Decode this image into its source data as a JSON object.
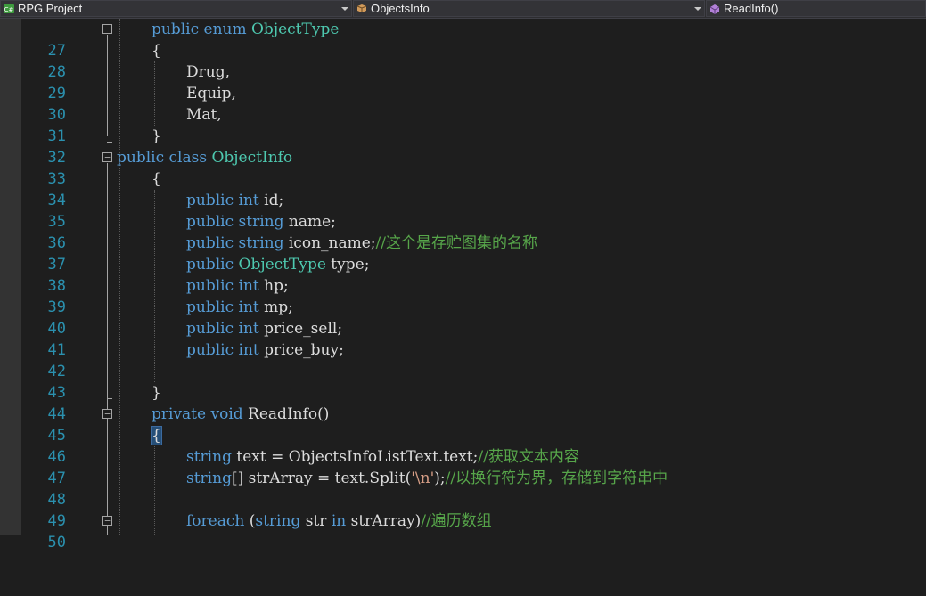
{
  "navbar": {
    "project": "RPG Project",
    "class": "ObjectsInfo",
    "member": "ReadInfo()"
  },
  "colors": {
    "background": "#1e1e1e",
    "keyword": "#569cd6",
    "type": "#4ec9b0",
    "comment": "#57a64a",
    "string": "#d69d85",
    "line_number": "#2b91af",
    "text": "#dcdcdc"
  },
  "lines": [
    {
      "n": "27",
      "text": "public enum ObjectType"
    },
    {
      "n": "28",
      "text": "{"
    },
    {
      "n": "29",
      "text": "Drug,"
    },
    {
      "n": "30",
      "text": "Equip,"
    },
    {
      "n": "31",
      "text": "Mat,"
    },
    {
      "n": "32",
      "text": "}"
    },
    {
      "n": "33",
      "text": "public class ObjectInfo"
    },
    {
      "n": "34",
      "text": "{"
    },
    {
      "n": "35",
      "text": "public int id;"
    },
    {
      "n": "36",
      "text": "public string name;"
    },
    {
      "n": "37",
      "text": "public string icon_name;//这个是存贮图集的名称"
    },
    {
      "n": "38",
      "text": "public ObjectType type;"
    },
    {
      "n": "39",
      "text": "public int hp;"
    },
    {
      "n": "40",
      "text": "public int mp;"
    },
    {
      "n": "41",
      "text": "public int price_sell;"
    },
    {
      "n": "42",
      "text": "public int price_buy;"
    },
    {
      "n": "43",
      "text": ""
    },
    {
      "n": "44",
      "text": "}"
    },
    {
      "n": "45",
      "text": "private void ReadInfo()"
    },
    {
      "n": "46",
      "text": "{"
    },
    {
      "n": "47",
      "text": "string text = ObjectsInfoListText.text;//获取文本内容"
    },
    {
      "n": "48",
      "text": "string[] strArray = text.Split('\\n');//以换行符为界，存储到字符串中"
    },
    {
      "n": "49",
      "text": ""
    },
    {
      "n": "50",
      "text": "foreach (string str in strArray)//遍历数组"
    }
  ]
}
